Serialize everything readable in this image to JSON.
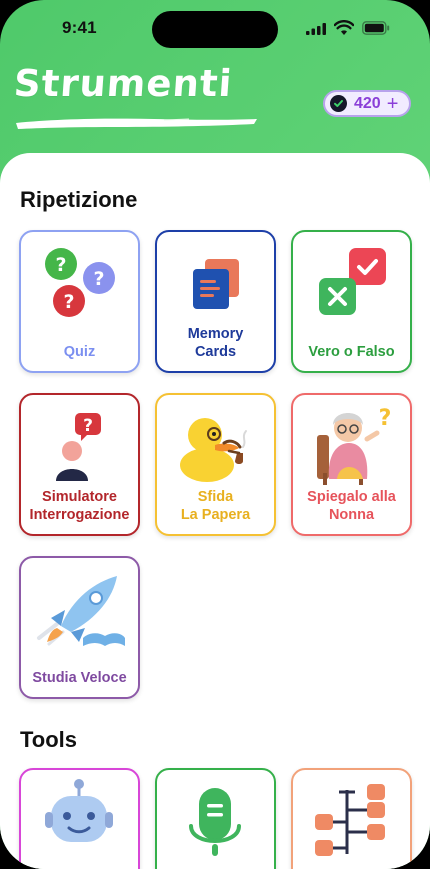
{
  "status": {
    "time": "9:41"
  },
  "header": {
    "title": "Strumenti",
    "coins": "420",
    "plus": "+"
  },
  "sections": {
    "review": {
      "title": "Ripetizione"
    },
    "tools": {
      "title": "Tools"
    }
  },
  "cards": {
    "quiz": {
      "label": "Quiz",
      "color": "#8ea2f2",
      "text_color": "#7b8ff0"
    },
    "memory": {
      "label": "Memory\nCards",
      "color": "#1d3fa8",
      "text_color": "#1e3a9a"
    },
    "truefalse": {
      "label": "Vero o Falso",
      "color": "#35b04a",
      "text_color": "#2c9e3f"
    },
    "simulator": {
      "label": "Simulatore\nInterrogazione",
      "color": "#b3262b",
      "text_color": "#b3262b"
    },
    "duck": {
      "label": "Sfida\nLa Papera",
      "color": "#f5c133",
      "text_color": "#e8b020"
    },
    "grandma": {
      "label": "Spiegalo alla\nNonna",
      "color": "#ef6a6a",
      "text_color": "#e6535b"
    },
    "speed": {
      "label": "Studia Veloce",
      "color": "#8d5aa8",
      "text_color": "#7f4aa0"
    }
  },
  "icons": [
    "question-bubbles-icon",
    "memory-cards-icon",
    "check-cross-icon",
    "student-question-icon",
    "duck-icon",
    "grandma-icon",
    "rocket-book-icon",
    "robot-icon",
    "microphone-icon",
    "mindmap-icon",
    "coin-check-icon"
  ]
}
